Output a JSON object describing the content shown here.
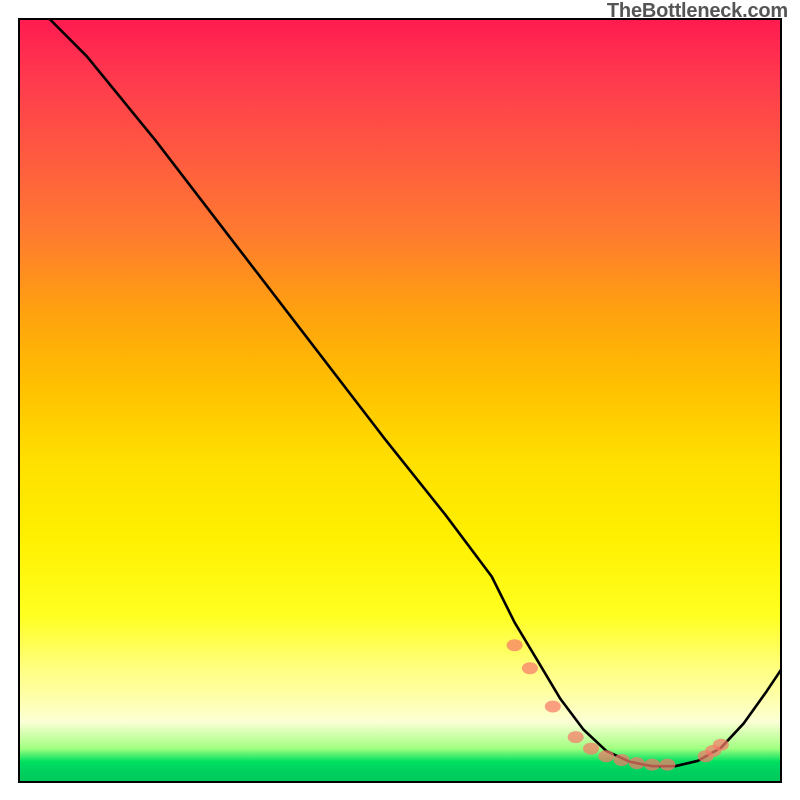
{
  "watermark": "TheBottleneck.com",
  "chart_data": {
    "type": "line",
    "title": "",
    "xlabel": "",
    "ylabel": "",
    "xlim": [
      0,
      100
    ],
    "ylim": [
      0,
      100
    ],
    "x": [
      4,
      9,
      18,
      28,
      38,
      48,
      56,
      62,
      65,
      68,
      71,
      74,
      77,
      80,
      83,
      86,
      89,
      92,
      95,
      98,
      100
    ],
    "values": [
      100,
      95,
      84,
      71,
      58,
      45,
      35,
      27,
      21,
      16,
      11,
      7,
      4.2,
      2.8,
      2.2,
      2.2,
      2.9,
      4.6,
      7.8,
      12,
      15
    ],
    "series": [
      {
        "name": "curve",
        "x": [
          4,
          9,
          18,
          28,
          38,
          48,
          56,
          62,
          65,
          68,
          71,
          74,
          77,
          80,
          83,
          86,
          89,
          92,
          95,
          98,
          100
        ],
        "values": [
          100,
          95,
          84,
          71,
          58,
          45,
          35,
          27,
          21,
          16,
          11,
          7,
          4.2,
          2.8,
          2.2,
          2.2,
          2.9,
          4.6,
          7.8,
          12,
          15
        ]
      },
      {
        "name": "dots",
        "x": [
          65,
          67,
          70,
          73,
          75,
          77,
          79,
          81,
          83,
          85,
          90,
          91,
          92
        ],
        "values": [
          18,
          15,
          10,
          6,
          4.5,
          3.5,
          3.0,
          2.6,
          2.4,
          2.4,
          3.5,
          4.2,
          5.0
        ]
      }
    ],
    "colors": {
      "curve": "#000000",
      "dots": "#f77a6a"
    }
  }
}
